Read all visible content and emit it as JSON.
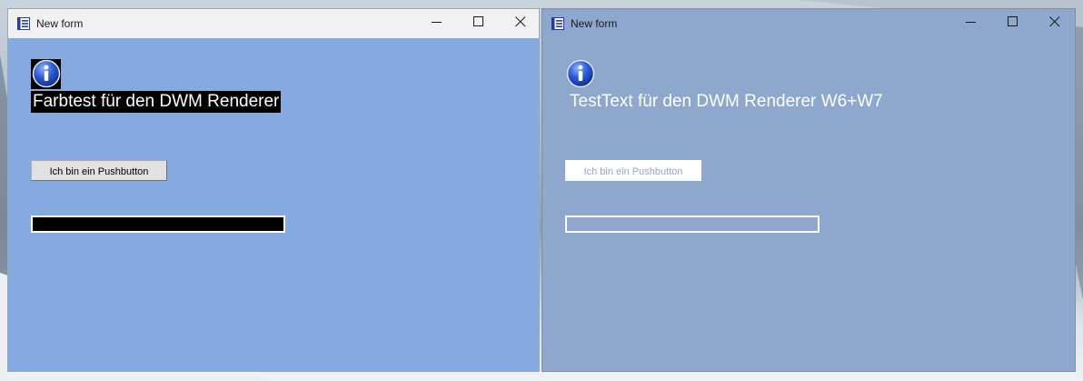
{
  "windows": [
    {
      "title": "New form",
      "headline": "Farbtest für den DWM Renderer",
      "button_label": "Ich bin ein Pushbutton",
      "progress_fraction": 0
    },
    {
      "title": "New form",
      "headline": "TestText für den DWM Renderer W6+W7",
      "button_label": "Ich bin ein Pushbutton",
      "progress_fraction": 0
    }
  ],
  "icons": {
    "app": "form-app-icon",
    "info": "info-icon",
    "minimize": "minimize-icon",
    "maximize": "maximize-icon",
    "close": "close-icon"
  },
  "colors": {
    "client_left": "#84aadf",
    "client_right": "#8ea7cd",
    "titlebar_left": "#f1f1f1",
    "headline_left_bg": "#000000",
    "headline_text": "#ffffff"
  }
}
